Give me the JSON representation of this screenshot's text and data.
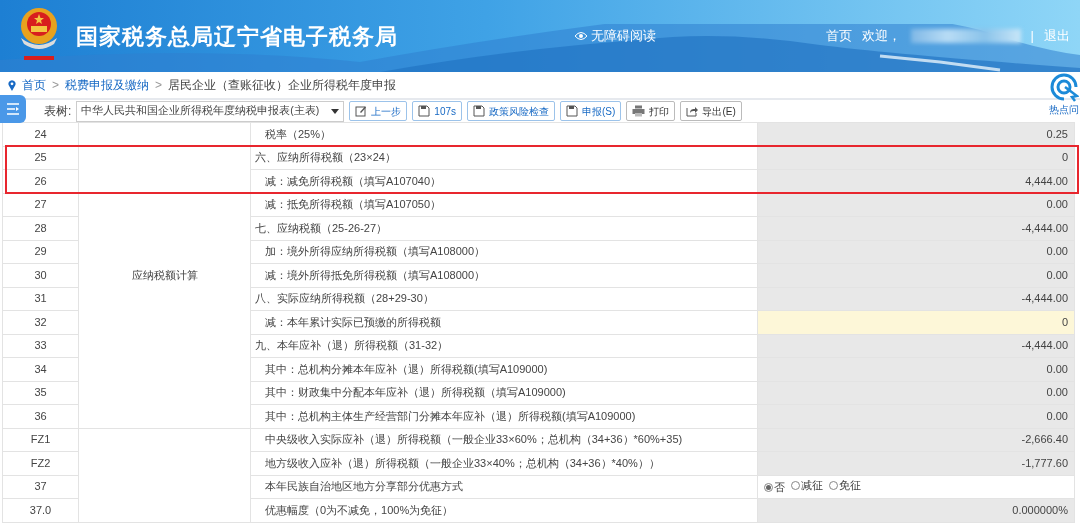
{
  "header": {
    "title": "国家税务总局辽宁省电子税务局",
    "accessibility": "无障碍阅读",
    "home": "首页",
    "welcome": "欢迎，",
    "separator": "|",
    "logout": "退出"
  },
  "breadcrumb": {
    "separator": ">",
    "items": [
      {
        "label": "首页",
        "link": true
      },
      {
        "label": "税费申报及缴纳",
        "link": true
      },
      {
        "label": "居民企业（查账征收）企业所得税年度申报",
        "link": false
      }
    ]
  },
  "toolbar": {
    "tree_label": "表树:",
    "tree_value": "中华人民共和国企业所得税年度纳税申报表(主表)",
    "buttons": [
      {
        "label": "上一步",
        "kind": "edit",
        "emphasis": true
      },
      {
        "label": "107s",
        "kind": "save",
        "emphasis": true
      },
      {
        "label": "政策风险检查",
        "kind": "save",
        "emphasis": true
      },
      {
        "label": "申报(S)",
        "kind": "save",
        "emphasis": true
      },
      {
        "label": "打印",
        "kind": "print",
        "emphasis": false
      },
      {
        "label": "导出(E)",
        "kind": "export",
        "emphasis": false
      }
    ]
  },
  "hotspot": {
    "label": "热点问"
  },
  "table": {
    "groups": [
      {
        "label": "应纳税额计算",
        "rows": [
          {
            "no": "24",
            "label": "税率（25%）",
            "indented": true,
            "cell": {
              "kind": "readonly",
              "text": "0.25"
            },
            "highlighted": false
          },
          {
            "no": "25",
            "label": "六、应纳所得税额（23×24）",
            "indented": false,
            "cell": {
              "kind": "readonly",
              "text": "0"
            },
            "highlighted": true
          },
          {
            "no": "26",
            "label": "减：减免所得税额（填写A107040）",
            "indented": true,
            "cell": {
              "kind": "readonly",
              "text": "4,444.00"
            },
            "highlighted": true
          },
          {
            "no": "27",
            "label": "减：抵免所得税额（填写A107050）",
            "indented": true,
            "cell": {
              "kind": "readonly",
              "text": "0.00"
            },
            "highlighted": false
          },
          {
            "no": "28",
            "label": "七、应纳税额（25-26-27）",
            "indented": false,
            "cell": {
              "kind": "readonly",
              "text": "-4,444.00"
            },
            "highlighted": false
          },
          {
            "no": "29",
            "label": "加：境外所得应纳所得税额（填写A108000）",
            "indented": true,
            "cell": {
              "kind": "readonly",
              "text": "0.00"
            },
            "highlighted": false
          },
          {
            "no": "30",
            "label": "减：境外所得抵免所得税额（填写A108000）",
            "indented": true,
            "cell": {
              "kind": "readonly",
              "text": "0.00"
            },
            "highlighted": false
          },
          {
            "no": "31",
            "label": "八、实际应纳所得税额（28+29-30）",
            "indented": false,
            "cell": {
              "kind": "readonly",
              "text": "-4,444.00"
            },
            "highlighted": false
          },
          {
            "no": "32",
            "label": "减：本年累计实际已预缴的所得税额",
            "indented": true,
            "cell": {
              "kind": "input",
              "text": "0"
            },
            "highlighted": false
          },
          {
            "no": "33",
            "label": "九、本年应补（退）所得税额（31-32）",
            "indented": false,
            "cell": {
              "kind": "readonly",
              "text": "-4,444.00"
            },
            "highlighted": false
          },
          {
            "no": "34",
            "label": "其中：总机构分摊本年应补（退）所得税额(填写A109000)",
            "indented": true,
            "cell": {
              "kind": "readonly",
              "text": "0.00"
            },
            "highlighted": false
          },
          {
            "no": "35",
            "label": "其中：财政集中分配本年应补（退）所得税额（填写A109000)",
            "indented": true,
            "cell": {
              "kind": "readonly",
              "text": "0.00"
            },
            "highlighted": false
          },
          {
            "no": "36",
            "label": "其中：总机构主体生产经营部门分摊本年应补（退）所得税额(填写A109000)",
            "indented": true,
            "cell": {
              "kind": "readonly",
              "text": "0.00"
            },
            "highlighted": false
          }
        ]
      },
      {
        "rows": [
          {
            "no": "FZ1",
            "label": "中央级收入实际应补（退）所得税额（一般企业33×60%；总机构（34+36）*60%+35)",
            "indented": true,
            "cell": {
              "kind": "readonly",
              "text": "-2,666.40"
            },
            "highlighted": false
          },
          {
            "no": "FZ2",
            "label": "地方级收入应补（退）所得税额（一般企业33×40%；总机构（34+36）*40%））",
            "indented": true,
            "cell": {
              "kind": "readonly",
              "text": "-1,777.60"
            },
            "highlighted": false
          },
          {
            "no": "37",
            "label": "本年民族自治地区地方分享部分优惠方式",
            "indented": true,
            "cell": {
              "kind": "radio",
              "options": [
                {
                  "label": "否",
                  "selected": true
                },
                {
                  "label": "减征",
                  "selected": false
                },
                {
                  "label": "免征",
                  "selected": false
                }
              ]
            },
            "highlighted": false
          },
          {
            "no": "37.0",
            "label": "优惠幅度（0为不减免，100%为免征）",
            "indented": true,
            "cell": {
              "kind": "readonly",
              "text": "0.000000%"
            },
            "highlighted": false
          }
        ]
      }
    ]
  }
}
